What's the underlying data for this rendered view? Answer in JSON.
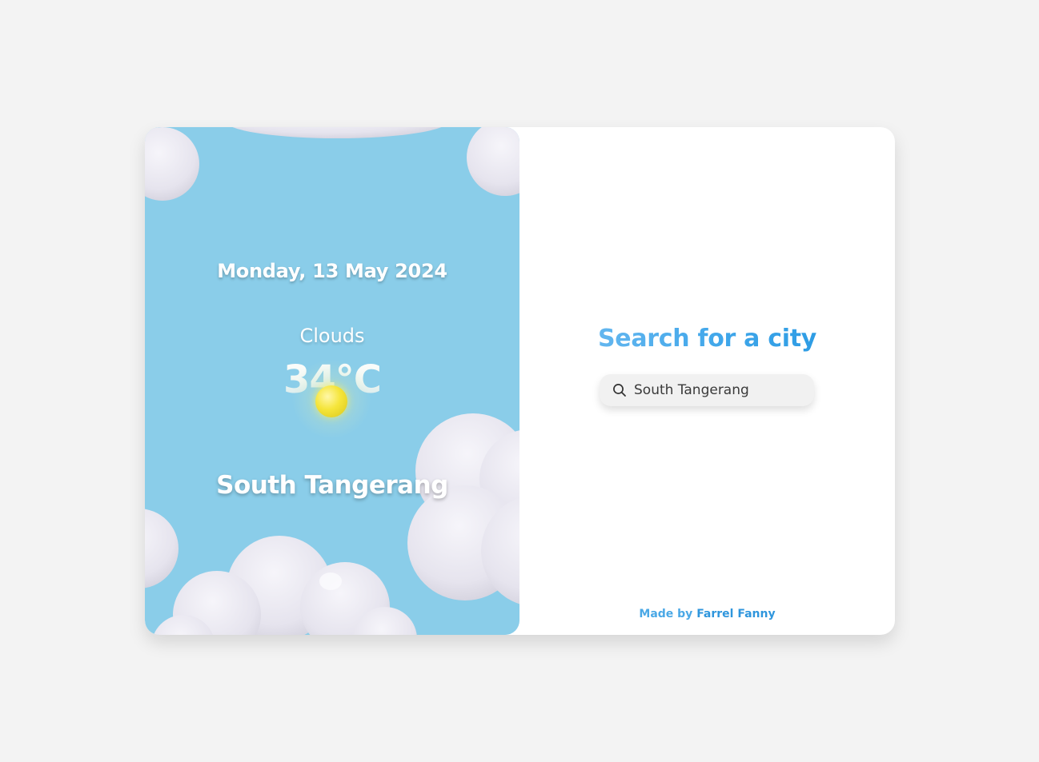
{
  "weather": {
    "date": "Monday, 13 May 2024",
    "condition": "Clouds",
    "temperature": "34°C",
    "city": "South Tangerang",
    "weather_icon": "sun-icon"
  },
  "search": {
    "title": "Search for a city",
    "input_value": "South Tangerang",
    "icon": "search-icon"
  },
  "footer": {
    "prefix": "Made by",
    "author": "Farrel Fanny"
  },
  "colors": {
    "page_background": "#f3f3f3",
    "weather_panel": "#8acde9",
    "accent": "#2f96dd"
  }
}
